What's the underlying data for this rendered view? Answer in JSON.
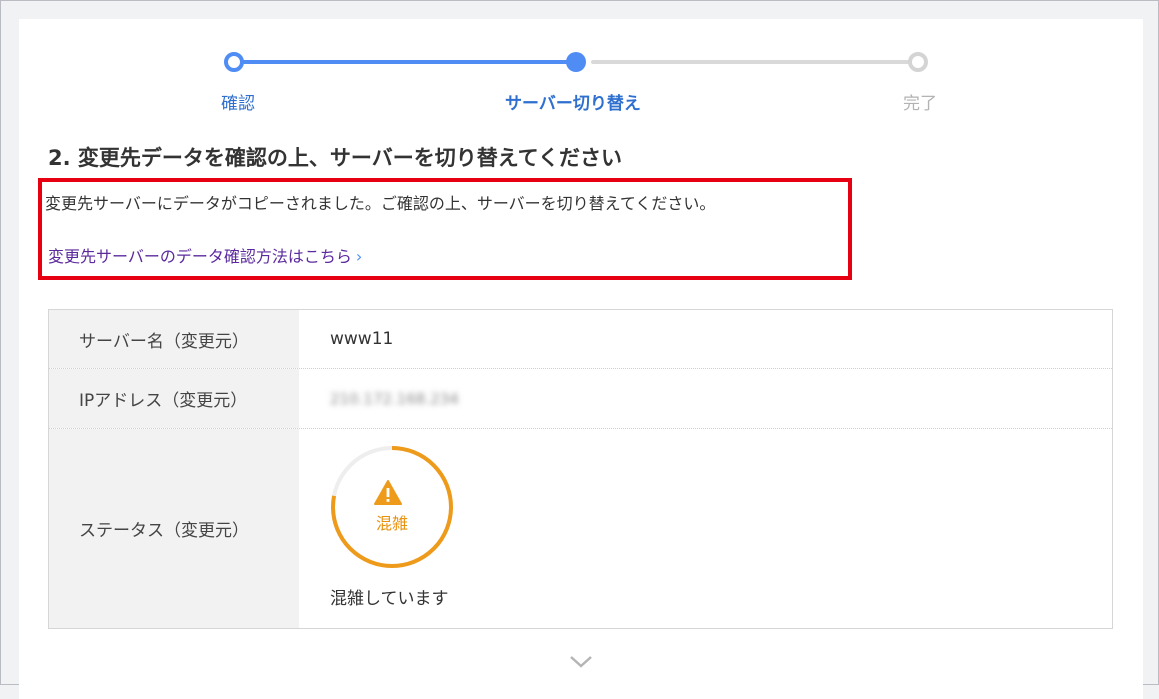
{
  "stepper": {
    "steps": [
      {
        "label": "確認",
        "state": "done"
      },
      {
        "label": "サーバー切り替え",
        "state": "current"
      },
      {
        "label": "完了",
        "state": "pending"
      }
    ]
  },
  "heading": "2. 変更先データを確認の上、サーバーを切り替えてください",
  "notice": {
    "message": "変更先サーバーにデータがコピーされました。ご確認の上、サーバーを切り替えてください。",
    "link_label": "変更先サーバーのデータ確認方法はこちら",
    "link_chevron": "›"
  },
  "table": {
    "rows": [
      {
        "label": "サーバー名（変更元）",
        "value": "www11"
      },
      {
        "label": "IPアドレス（変更元）",
        "value": "210.172.168.234"
      },
      {
        "label": "ステータス（変更元）"
      }
    ],
    "status": {
      "gauge_label": "混雑",
      "gauge_level_percent": 78,
      "icon": "warning-icon",
      "description": "混雑しています",
      "color": "#ee9a1a"
    }
  },
  "colors": {
    "accent": "#4f8df5",
    "highlight_border": "#e60012",
    "link": "#5b2a9e"
  }
}
